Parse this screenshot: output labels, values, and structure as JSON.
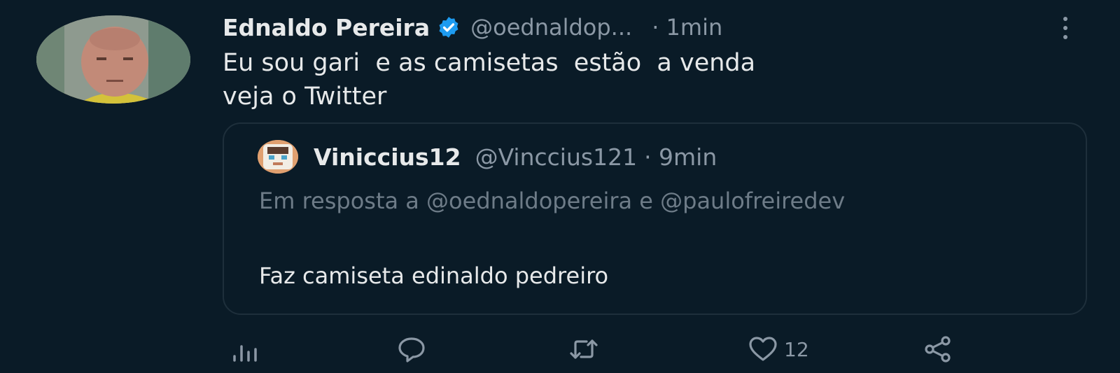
{
  "tweet": {
    "author_name": "Ednaldo Pereira",
    "author_handle": "@oednaldop...",
    "time": "· 1min",
    "text": "Eu sou gari  e as camisetas  estão  a venda\nveja o Twitter",
    "verified_icon": "verified-badge-icon",
    "verified_color": "#1d9bf0"
  },
  "quoted_tweet": {
    "author_name": "Viniccius12",
    "author_handle": "@Vinccius121",
    "time": "· 9min",
    "reply_context": "Em resposta a @oednaldopereira e @paulofreiredev",
    "text": "Faz camiseta edinaldo pedreiro"
  },
  "actions": {
    "analytics_icon": "analytics-icon",
    "reply_icon": "reply-icon",
    "retweet_icon": "retweet-icon",
    "like_icon": "heart-icon",
    "like_count": "12",
    "share_icon": "share-icon"
  },
  "colors": {
    "background": "#0a1b27",
    "secondary_text": "#8b98a5",
    "border": "#1e2f3b"
  }
}
